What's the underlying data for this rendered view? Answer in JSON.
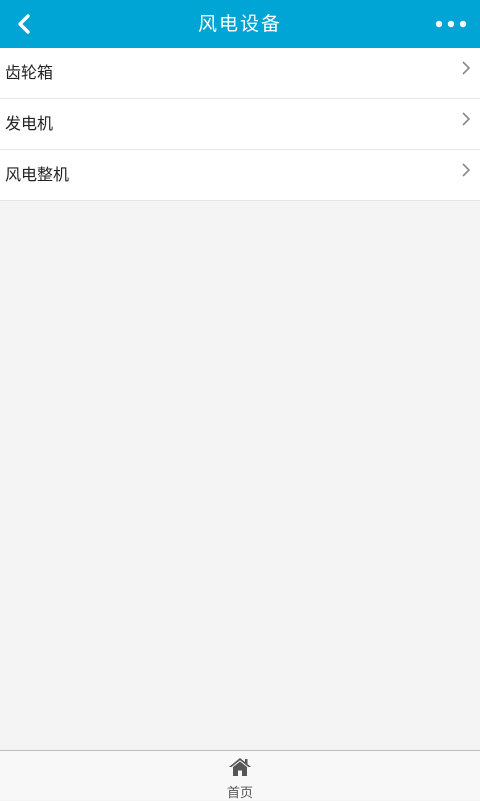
{
  "header": {
    "title": "风电设备",
    "back_icon": "chevron-left-icon",
    "more_icon": "more-dots-icon"
  },
  "list": {
    "items": [
      {
        "label": "齿轮箱"
      },
      {
        "label": "发电机"
      },
      {
        "label": "风电整机"
      }
    ]
  },
  "footer": {
    "home_label": "首页",
    "home_icon": "home-icon"
  },
  "colors": {
    "header_bg": "#00a5d5",
    "page_bg": "#f4f4f4"
  }
}
